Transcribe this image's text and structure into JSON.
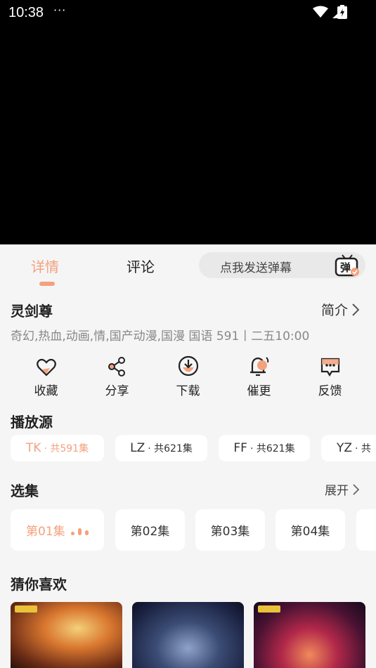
{
  "status": {
    "time": "10:38",
    "dots": "···"
  },
  "tabs": {
    "detail": "详情",
    "comment": "评论"
  },
  "danmu": {
    "placeholder": "点我发送弹幕",
    "icon_text": "弹"
  },
  "show": {
    "title": "灵剑尊",
    "intro": "简介",
    "meta": "奇幻,热血,动画,情,国产动漫,国漫 国语 591丨二五10:00"
  },
  "actions": [
    {
      "label": "收藏",
      "icon": "heart-icon"
    },
    {
      "label": "分享",
      "icon": "share-icon"
    },
    {
      "label": "下载",
      "icon": "download-icon"
    },
    {
      "label": "催更",
      "icon": "bell-icon"
    },
    {
      "label": "反馈",
      "icon": "feedback-icon"
    }
  ],
  "sources_title": "播放源",
  "sources": [
    {
      "code": "TK",
      "count": "· 共591集",
      "active": true
    },
    {
      "code": "LZ",
      "count": "· 共621集",
      "active": false
    },
    {
      "code": "FF",
      "count": "· 共621集",
      "active": false
    },
    {
      "code": "YZ",
      "count": "· 共",
      "active": false
    }
  ],
  "episodes_title": "选集",
  "expand": "展开",
  "episodes": [
    "第01集",
    "第02集",
    "第03集",
    "第04集"
  ],
  "recommend_title": "猜你喜欢",
  "colors": {
    "accent": "#f4a17d",
    "background": "#f5f5f5",
    "card": "#ffffff"
  }
}
